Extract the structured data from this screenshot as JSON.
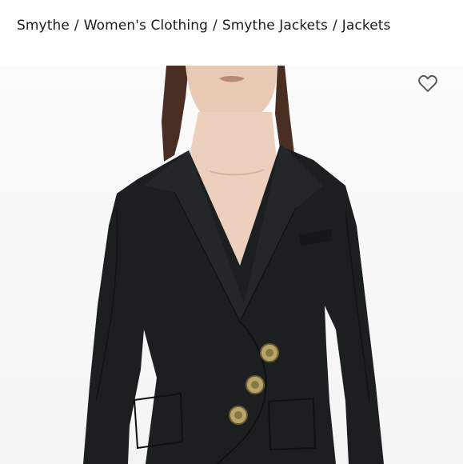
{
  "breadcrumb": {
    "items": [
      {
        "label": "Smythe"
      },
      {
        "label": "Women's Clothing"
      },
      {
        "label": "Smythe Jackets"
      },
      {
        "label": "Jackets"
      }
    ],
    "separator": "/"
  },
  "product_image": {
    "subject": "black asymmetric blazer with gold buttons",
    "favorite_icon": "heart-outline-icon"
  },
  "colors": {
    "jacket": "#1c1f20",
    "background": "#f6f6f6",
    "buttons": "#b9a46a",
    "text": "#1a1a1a"
  }
}
